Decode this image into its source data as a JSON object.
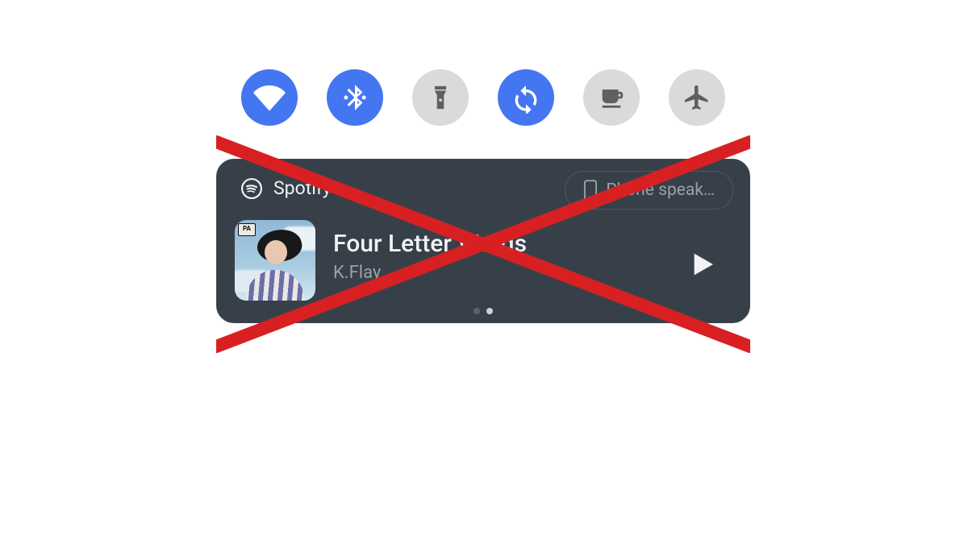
{
  "quick_settings": {
    "items": [
      {
        "name": "wifi",
        "active": true
      },
      {
        "name": "bluetooth",
        "active": true
      },
      {
        "name": "flashlight",
        "active": false
      },
      {
        "name": "auto-rotate",
        "active": true
      },
      {
        "name": "caffeine",
        "active": false
      },
      {
        "name": "airplane-mode",
        "active": false
      }
    ]
  },
  "media_card": {
    "app_name": "Spotify",
    "device_chip": "Phone speak…",
    "track_title": "Four Letter Words",
    "track_artist": "K.Flay",
    "album_art": {
      "parental_advisory": true,
      "description": "person with windblown dark hair shouting against blue sky"
    },
    "playback_state": "paused",
    "pager": {
      "count": 2,
      "active_index": 1
    }
  },
  "annotation": {
    "kind": "crossed-out",
    "color": "#d82023",
    "meaning": "media notification tile is marked as removed / disabled"
  }
}
